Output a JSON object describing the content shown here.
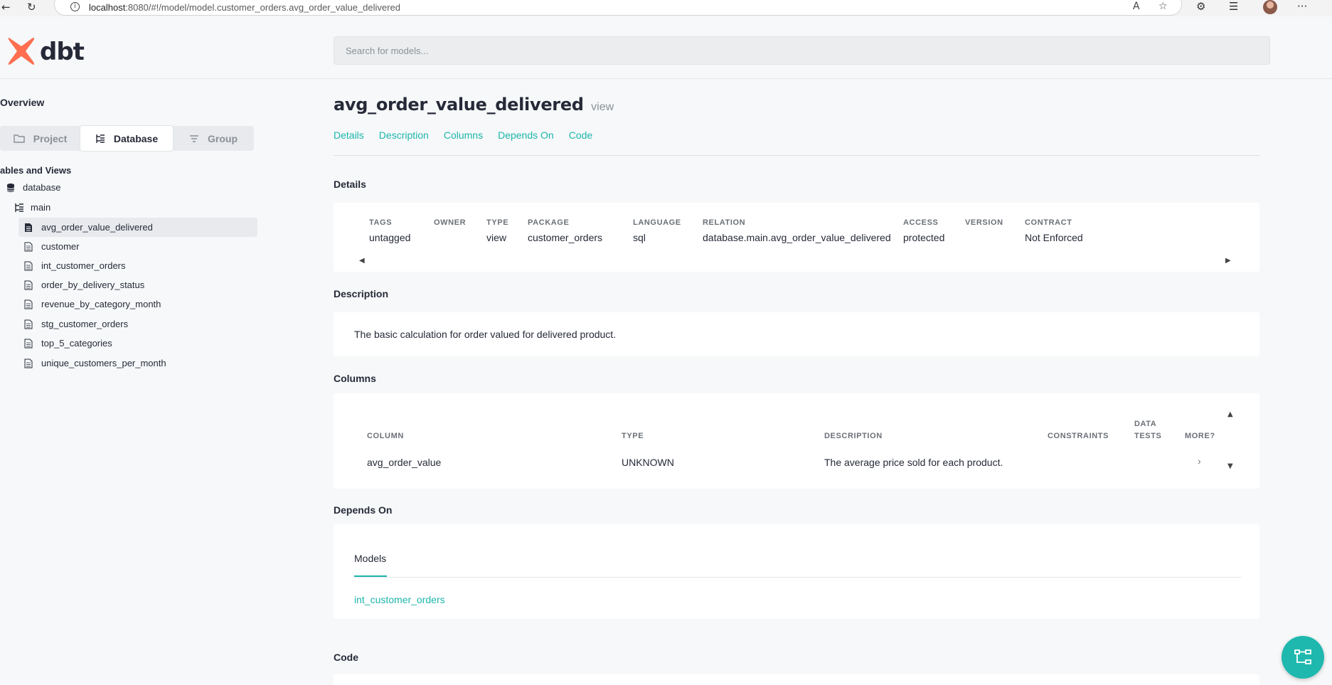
{
  "browser": {
    "url_host": "localhost",
    "url_rest": ":8080/#!/model/model.customer_orders.avg_order_value_delivered",
    "more_label": "···"
  },
  "header": {
    "logo_text": "dbt",
    "search_placeholder": "Search for models..."
  },
  "sidebar": {
    "overview_label": "Overview",
    "segments": [
      "Project",
      "Database",
      "Group"
    ],
    "active_segment": "Database",
    "tables_title": "ables and Views",
    "database_label": "database",
    "schema_label": "main",
    "models": [
      "avg_order_value_delivered",
      "customer",
      "int_customer_orders",
      "order_by_delivery_status",
      "revenue_by_category_month",
      "stg_customer_orders",
      "top_5_categories",
      "unique_customers_per_month"
    ],
    "active_model": "avg_order_value_delivered"
  },
  "main": {
    "title": "avg_order_value_delivered",
    "kind": "view",
    "tabs": [
      "Details",
      "Description",
      "Columns",
      "Depends On",
      "Code"
    ],
    "details": {
      "section_title": "Details",
      "fields": [
        {
          "label": "TAGS",
          "value": "untagged"
        },
        {
          "label": "OWNER",
          "value": ""
        },
        {
          "label": "TYPE",
          "value": "view"
        },
        {
          "label": "PACKAGE",
          "value": "customer_orders"
        },
        {
          "label": "LANGUAGE",
          "value": "sql"
        },
        {
          "label": "RELATION",
          "value": "database.main.avg_order_value_delivered"
        },
        {
          "label": "ACCESS",
          "value": "protected"
        },
        {
          "label": "VERSION",
          "value": ""
        },
        {
          "label": "CONTRACT",
          "value": "Not Enforced"
        }
      ]
    },
    "description": {
      "section_title": "Description",
      "text": "The basic calculation for order valued for delivered product."
    },
    "columns": {
      "section_title": "Columns",
      "headers": {
        "column": "COLUMN",
        "type": "TYPE",
        "description": "DESCRIPTION",
        "constraints": "CONSTRAINTS",
        "data_tests_1": "DATA",
        "data_tests_2": "TESTS",
        "more": "MORE?"
      },
      "rows": [
        {
          "column": "avg_order_value",
          "type": "UNKNOWN",
          "description": "The average price sold for each product.",
          "more": "›"
        }
      ]
    },
    "depends_on": {
      "section_title": "Depends On",
      "tab_label": "Models",
      "models": [
        "int_customer_orders"
      ]
    },
    "code": {
      "section_title": "Code"
    }
  },
  "colors": {
    "accent": "#1db5ac",
    "text": "#262a38",
    "muted": "#8b9097"
  }
}
